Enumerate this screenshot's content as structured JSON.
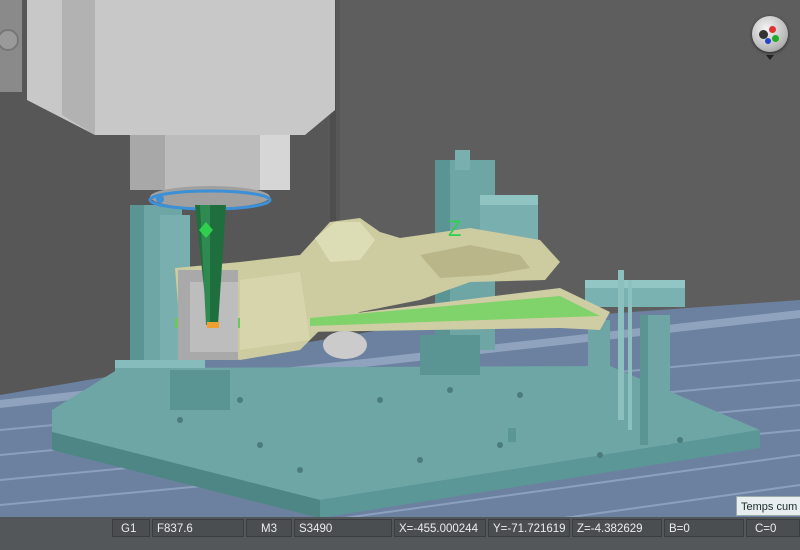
{
  "toolbar": {
    "view_widget_icon": "camera-view-icon"
  },
  "tooltip": {
    "text": "Temps cum"
  },
  "axis_marker": {
    "z_label": "Z"
  },
  "status": {
    "mode": "G1",
    "feed": "F837.6",
    "m_code": "M3",
    "spindle": "S3490",
    "x": "X=-455.000244",
    "y": "Y=-71.721619",
    "z": "Z=-4.382629",
    "b": "B=0",
    "c": "C=0"
  },
  "colors": {
    "background": "#5a5a5a",
    "table": "#6f85a3",
    "fixture": "#6fa3a3",
    "part": "#c9c79a",
    "tool": "#1f6e3e",
    "spindle": "#c9c9c9"
  }
}
